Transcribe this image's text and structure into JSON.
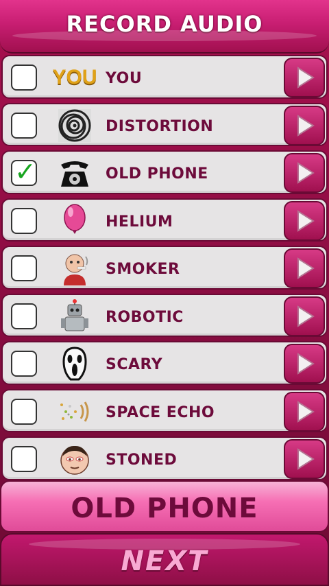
{
  "header": {
    "title": "RECORD AUDIO"
  },
  "effects": [
    {
      "label": "YOU",
      "icon": "you-text-icon",
      "checked": false
    },
    {
      "label": "DISTORTION",
      "icon": "distortion-swirl-icon",
      "checked": false
    },
    {
      "label": "OLD PHONE",
      "icon": "old-telephone-icon",
      "checked": true
    },
    {
      "label": "HELIUM",
      "icon": "balloon-icon",
      "checked": false
    },
    {
      "label": "SMOKER",
      "icon": "smoker-man-icon",
      "checked": false
    },
    {
      "label": "ROBOTIC",
      "icon": "robot-icon",
      "checked": false
    },
    {
      "label": "SCARY",
      "icon": "scream-mask-icon",
      "checked": false
    },
    {
      "label": "SPACE ECHO",
      "icon": "space-echo-icon",
      "checked": false
    },
    {
      "label": "STONED",
      "icon": "stoned-face-icon",
      "checked": false
    }
  ],
  "icon_text": {
    "you": "YOU"
  },
  "selected": {
    "label": "OLD PHONE"
  },
  "footer": {
    "next_label": "NEXT"
  },
  "colors": {
    "accent": "#d81c76",
    "label": "#6d0b3b",
    "check": "#17a51f"
  }
}
